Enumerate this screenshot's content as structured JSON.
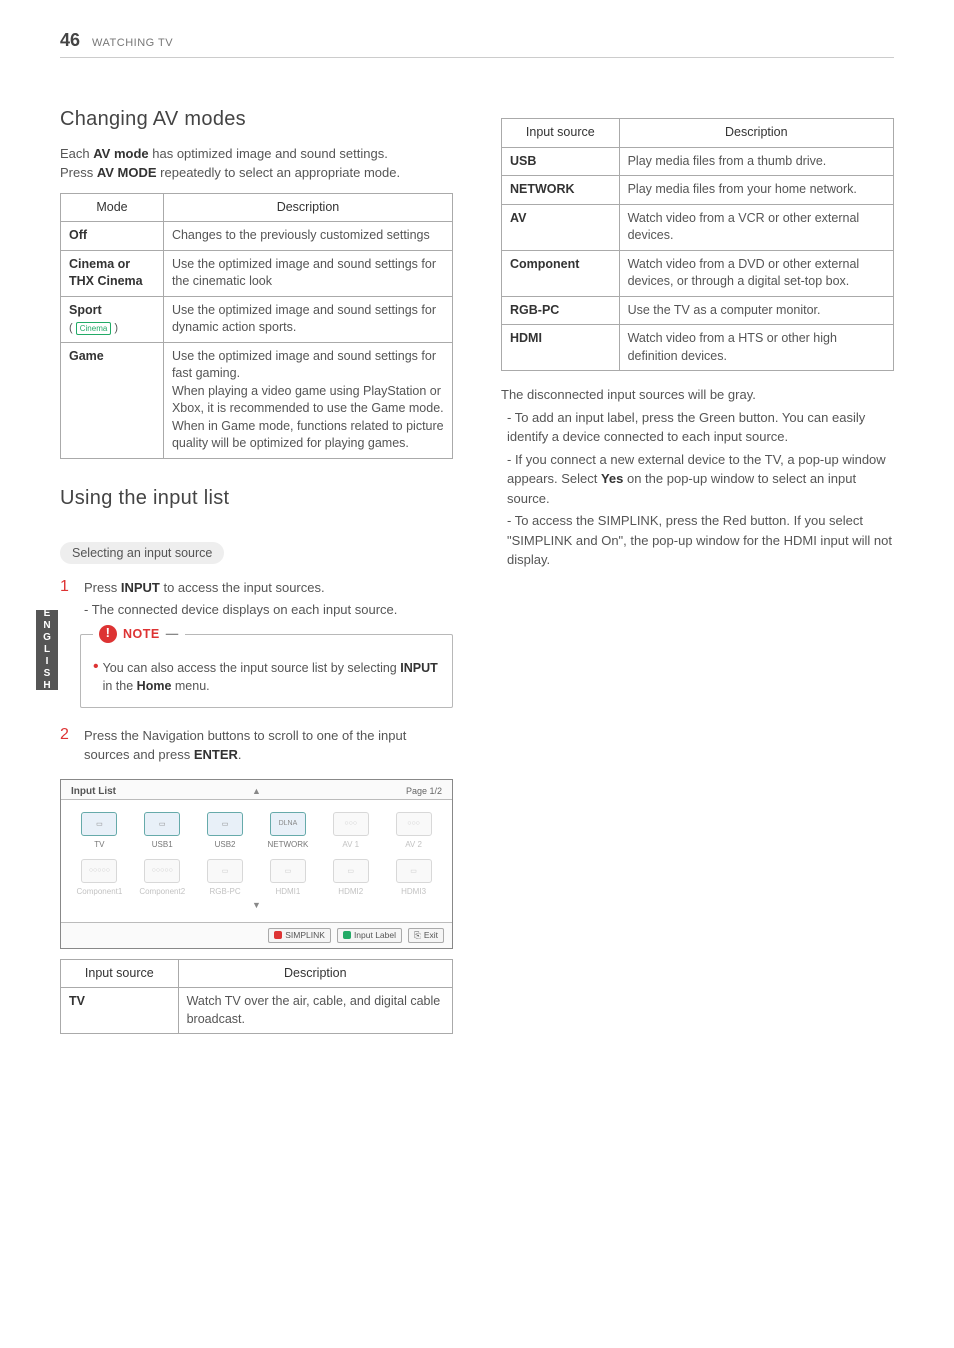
{
  "header": {
    "page_number": "46",
    "section": "WATCHING TV"
  },
  "side_tab": "ENGLISH",
  "left": {
    "h2_av": "Changing AV modes",
    "av_intro_1a": "Each ",
    "av_intro_1b": "AV mode",
    "av_intro_1c": " has optimized image and sound settings.",
    "av_intro_2a": "Press ",
    "av_intro_2b": "AV MODE",
    "av_intro_2c": " repeatedly to select an appropriate mode.",
    "av_table": {
      "head_mode": "Mode",
      "head_desc": "Description",
      "rows": [
        {
          "mode": "Off",
          "desc": "Changes to the previously customized settings"
        },
        {
          "mode": "Cinema or THX Cinema",
          "desc": "Use the optimized image and sound settings for the cinematic look"
        },
        {
          "mode": "Sport",
          "mode_sub": "( Cinema )",
          "desc": "Use the optimized image and sound settings for dynamic action sports."
        },
        {
          "mode": "Game",
          "desc": "Use the optimized image and sound settings for fast gaming.\nWhen playing a video game using PlayStation or Xbox, it is recommended to use the Game mode.\nWhen in Game mode, functions related to picture quality will be optimized for playing games."
        }
      ]
    },
    "h2_input": "Using the input list",
    "sub_select": "Selecting an input source",
    "step1": {
      "num": "1",
      "a": "Press ",
      "b": "INPUT",
      "c": " to access the input sources.",
      "sub": "- The connected device displays on each input source."
    },
    "note": {
      "title": "NOTE",
      "a": "You can also access the input source list by selecting ",
      "b": "INPUT",
      "c": " in the ",
      "d": "Home",
      "e": " menu."
    },
    "step2": {
      "num": "2",
      "a": "Press the Navigation buttons to scroll to one of the input sources and press ",
      "b": "ENTER",
      "c": "."
    },
    "panel": {
      "title": "Input List",
      "page": "Page 1/2",
      "items": [
        {
          "label": "TV",
          "active": true
        },
        {
          "label": "USB1",
          "active": true
        },
        {
          "label": "USB2",
          "active": true
        },
        {
          "label": "NETWORK",
          "active": true,
          "tag": "DLNA"
        },
        {
          "label": "AV 1",
          "active": false
        },
        {
          "label": "AV 2",
          "active": false
        },
        {
          "label": "Component1",
          "active": false
        },
        {
          "label": "Component2",
          "active": false
        },
        {
          "label": "RGB-PC",
          "active": false
        },
        {
          "label": "HDMI1",
          "active": false
        },
        {
          "label": "HDMI2",
          "active": false
        },
        {
          "label": "HDMI3",
          "active": false
        }
      ],
      "footer": {
        "simplink": "SIMPLINK",
        "inputlabel": "Input Label",
        "exit": "Exit"
      }
    },
    "src_table": {
      "head_src": "Input source",
      "head_desc": "Description",
      "rows": [
        {
          "src": "TV",
          "desc": "Watch TV over the air, cable, and digital cable broadcast."
        }
      ]
    }
  },
  "right": {
    "src_table": {
      "head_src": "Input source",
      "head_desc": "Description",
      "rows": [
        {
          "src": "USB",
          "desc": "Play media files from a thumb drive."
        },
        {
          "src": "NETWORK",
          "desc": "Play media files from your home network."
        },
        {
          "src": "AV",
          "desc": "Watch video from a VCR or other external devices."
        },
        {
          "src": "Component",
          "desc": "Watch video from a DVD or other external devices, or through a digital set-top box."
        },
        {
          "src": "RGB-PC",
          "desc": "Use the TV as a computer monitor."
        },
        {
          "src": "HDMI",
          "desc": "Watch video from a HTS or other high definition devices."
        }
      ]
    },
    "para1": "The disconnected input sources will be gray.",
    "dash1": "- To add an input label, press the Green button. You can easily identify a device connected to each input source.",
    "dash2a": "- If you connect a new external device to the TV, a pop-up window appears. Select ",
    "dash2b": "Yes",
    "dash2c": " on the pop-up window to select an input source.",
    "dash3": "- To access the SIMPLINK, press the Red button. If you select \"SIMPLINK and On\", the pop-up window for the HDMI input will not display."
  }
}
